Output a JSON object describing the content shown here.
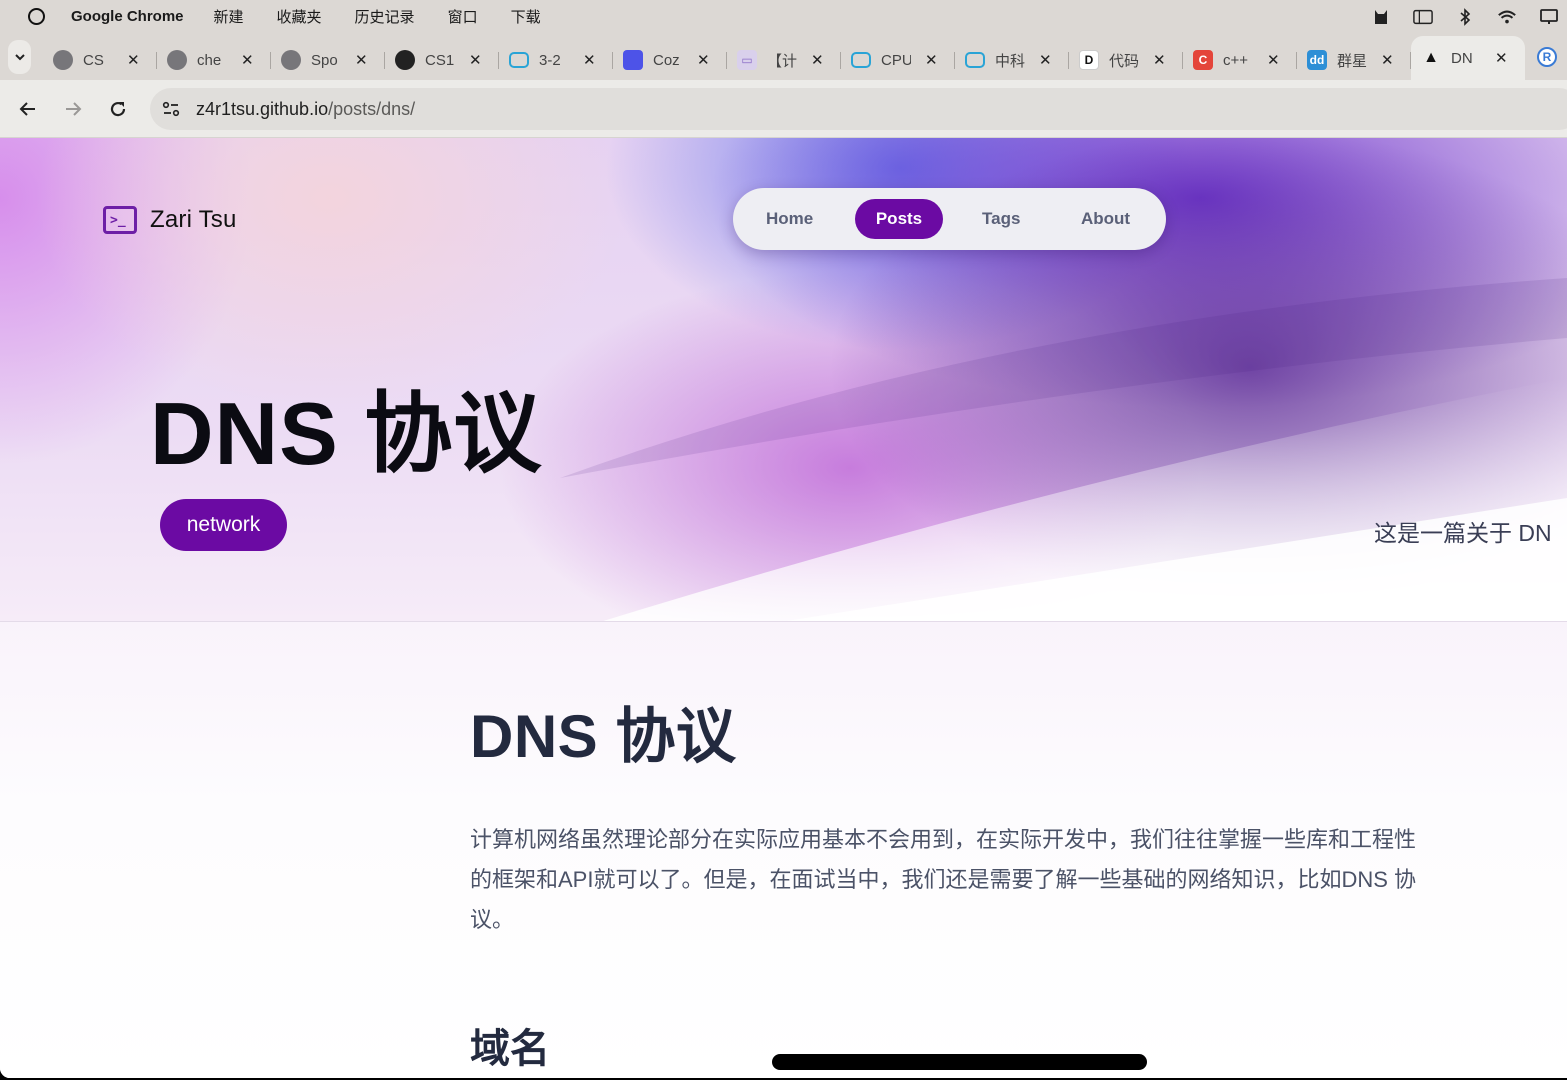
{
  "menubar": {
    "app_name": "Google Chrome",
    "items": [
      "新建",
      "收藏夹",
      "历史记录",
      "窗口",
      "下载"
    ],
    "status_icons": [
      "cat-app-icon",
      "sidebar-icon",
      "bluetooth-icon",
      "wifi-icon",
      "display-icon"
    ]
  },
  "tabs": [
    {
      "title": "CS",
      "icon": "globe-icon",
      "fav": "",
      "favclass": "fav-globe"
    },
    {
      "title": "che",
      "icon": "colorful-app-icon",
      "fav": "",
      "favclass": "fav-globe"
    },
    {
      "title": "Spo",
      "icon": "globe-icon",
      "fav": "",
      "favclass": "fav-globe"
    },
    {
      "title": "CS1",
      "icon": "github-icon",
      "fav": "",
      "favclass": "fav-github"
    },
    {
      "title": "3-2",
      "icon": "bilibili-icon",
      "fav": "",
      "favclass": "fav-bili"
    },
    {
      "title": "Coz",
      "icon": "coze-icon",
      "fav": "",
      "favclass": "fav-coze"
    },
    {
      "title": "【计",
      "icon": "monitor-icon",
      "fav": "▭",
      "favclass": "fav-monitor"
    },
    {
      "title": "CPU",
      "icon": "bilibili-icon",
      "fav": "",
      "favclass": "fav-bili"
    },
    {
      "title": "中科",
      "icon": "bilibili-icon",
      "fav": "",
      "favclass": "fav-bili"
    },
    {
      "title": "代码",
      "icon": "dm-icon",
      "fav": "D",
      "favclass": "fav-dm"
    },
    {
      "title": "c++",
      "icon": "c-icon",
      "fav": "C",
      "favclass": "fav-c"
    },
    {
      "title": "群星",
      "icon": "dd-icon",
      "fav": "dd",
      "favclass": "fav-dd"
    },
    {
      "title": "DN",
      "icon": "astro-icon",
      "fav": "▲",
      "favclass": "fav-astro",
      "active": true
    }
  ],
  "extra_tab_icon": "R",
  "address_bar": {
    "host": "z4r1tsu.github.io",
    "path": "/posts/dns/"
  },
  "site": {
    "logo_glyph": ">_",
    "name": "Zari Tsu",
    "nav": [
      "Home",
      "Posts",
      "Tags",
      "About"
    ],
    "active_nav": "Posts"
  },
  "hero": {
    "title": "DNS 协议",
    "tag": "network",
    "summary": "这是一篇关于 DN"
  },
  "article": {
    "title": "DNS 协议",
    "paragraph": "计算机网络虽然理论部分在实际应用基本不会用到，在实际开发中，我们往往掌握一些库和工程性的框架和API就可以了。但是，在面试当中，我们还是需要了解一些基础的网络知识，比如DNS 协议。",
    "section_heading": "域名"
  },
  "colors": {
    "accent": "#6b0aa3",
    "heading": "#232a3f",
    "body_text": "#4b5267",
    "nav_text": "#5a6078"
  }
}
